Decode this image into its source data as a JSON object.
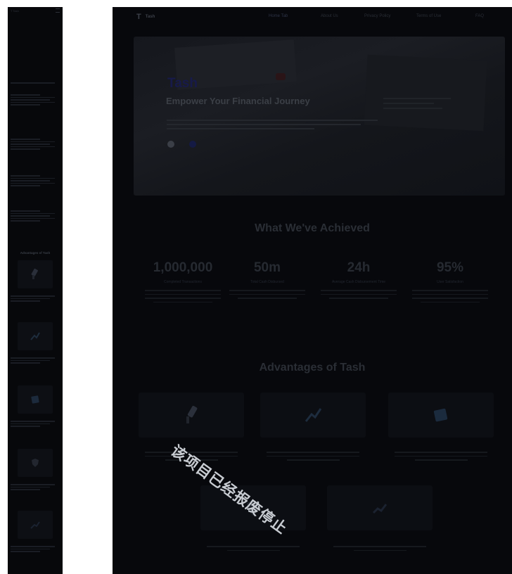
{
  "desktop": {
    "brand": "Tash",
    "nav": [
      "Home Tab",
      "About Us",
      "Privacy Policy",
      "Terms of Use",
      "FAQ"
    ],
    "hero": {
      "title": "Tash",
      "subtitle": "Empower Your Financial Journey"
    },
    "achievements": {
      "title": "What We've Achieved",
      "stats": [
        {
          "value": "1,000,000",
          "label": "Completed Transactions"
        },
        {
          "value": "50m",
          "label": "Total Cash Disbursed"
        },
        {
          "value": "24h",
          "label": "Average Cash Disbursement Time"
        },
        {
          "value": "95%",
          "label": "User Satisfaction"
        }
      ]
    },
    "advantages": {
      "title": "Advantages of Tash"
    }
  },
  "mobile": {
    "advantages_title": "Advantages of Tash"
  },
  "watermark": "该项目已经报废停止",
  "colors": {
    "background": "#07080c",
    "brand_blue": "#171a4a"
  },
  "icons": [
    "credit-card-icon",
    "chart-icon",
    "wallet-icon",
    "shield-icon"
  ]
}
